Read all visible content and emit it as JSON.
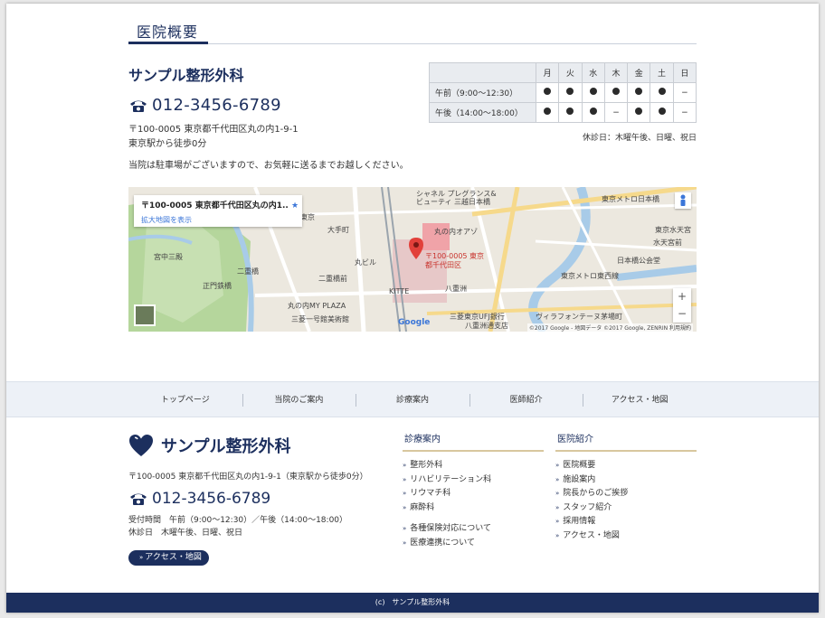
{
  "section": {
    "title": "医院概要"
  },
  "clinic": {
    "name": "サンプル整形外科",
    "tel": "012-3456-6789",
    "address": "〒100-0005  東京都千代田区丸の内1-9-1",
    "access": "東京駅から徒歩0分",
    "parking": "当院は駐車場がございますので、お気軽に送るまでお越しください。"
  },
  "hours": {
    "days": [
      "月",
      "火",
      "水",
      "木",
      "金",
      "土",
      "日"
    ],
    "rows": [
      {
        "label": "午前（9:00〜12:30）",
        "cells": [
          "●",
          "●",
          "●",
          "●",
          "●",
          "●",
          "−"
        ]
      },
      {
        "label": "午後（14:00〜18:00）",
        "cells": [
          "●",
          "●",
          "●",
          "−",
          "●",
          "●",
          "−"
        ]
      }
    ],
    "closed": "休診日：木曜午後、日曜、祝日"
  },
  "map": {
    "card_address": "〒100-0005 東京都千代田区丸の内1..",
    "card_link": "拡大地図を表示",
    "pin_label_1": "〒100-0005 東京",
    "pin_label_2": "都千代田区",
    "zoom_in": "+",
    "zoom_out": "−",
    "attribution": "©2017 Google - 地図データ ©2017 Google, ZENRIN  利用規約",
    "google": "Google",
    "labels": [
      "シャネル プレグランス&",
      "ビューティ 三越日本橋",
      "東京メトロ日本橋",
      "大手町",
      "丸の内オアゾ",
      "宮中三殿",
      "二重橋",
      "正門鉄橋",
      "丸の内MY PLAZA",
      "三菱一号館美術館",
      "KITTE",
      "八重洲",
      "三菱東京UFJ銀行",
      "八重洲通支店",
      "日本橋公会堂",
      "東京メトロ東西線",
      "ヴィラフォンテーヌ茅場町",
      "東京水天宮",
      "丸ビル",
      "二重橋前",
      "水天宮前",
      "東京"
    ]
  },
  "nav": [
    "トップページ",
    "当院のご案内",
    "診療案内",
    "医師紹介",
    "アクセス・地図"
  ],
  "footer": {
    "name": "サンプル整形外科",
    "address": "〒100-0005 東京都千代田区丸の内1-9-1（東京駅から徒歩0分）",
    "tel": "012-3456-6789",
    "hours_line": "受付時間　午前（9:00〜12:30）／午後（14:00〜18:00）",
    "closed_line": "休診日　木曜午後、日曜、祝日",
    "access_button": "アクセス・地図",
    "col1": {
      "title": "診療案内",
      "items": [
        "整形外科",
        "リハビリテーション科",
        "リウマチ科",
        "麻酔科"
      ],
      "items2": [
        "各種保険対応について",
        "医療連携について"
      ]
    },
    "col2": {
      "title": "医院紹介",
      "items": [
        "医院概要",
        "施設案内",
        "院長からのご挨拶",
        "スタッフ紹介",
        "採用情報",
        "アクセス・地図"
      ]
    },
    "copyright": "(c)　サンプル整形外科"
  },
  "colors": {
    "navy": "#1c2f5e",
    "gold": "#d8c79e",
    "nav_bg": "#edf1f7"
  }
}
